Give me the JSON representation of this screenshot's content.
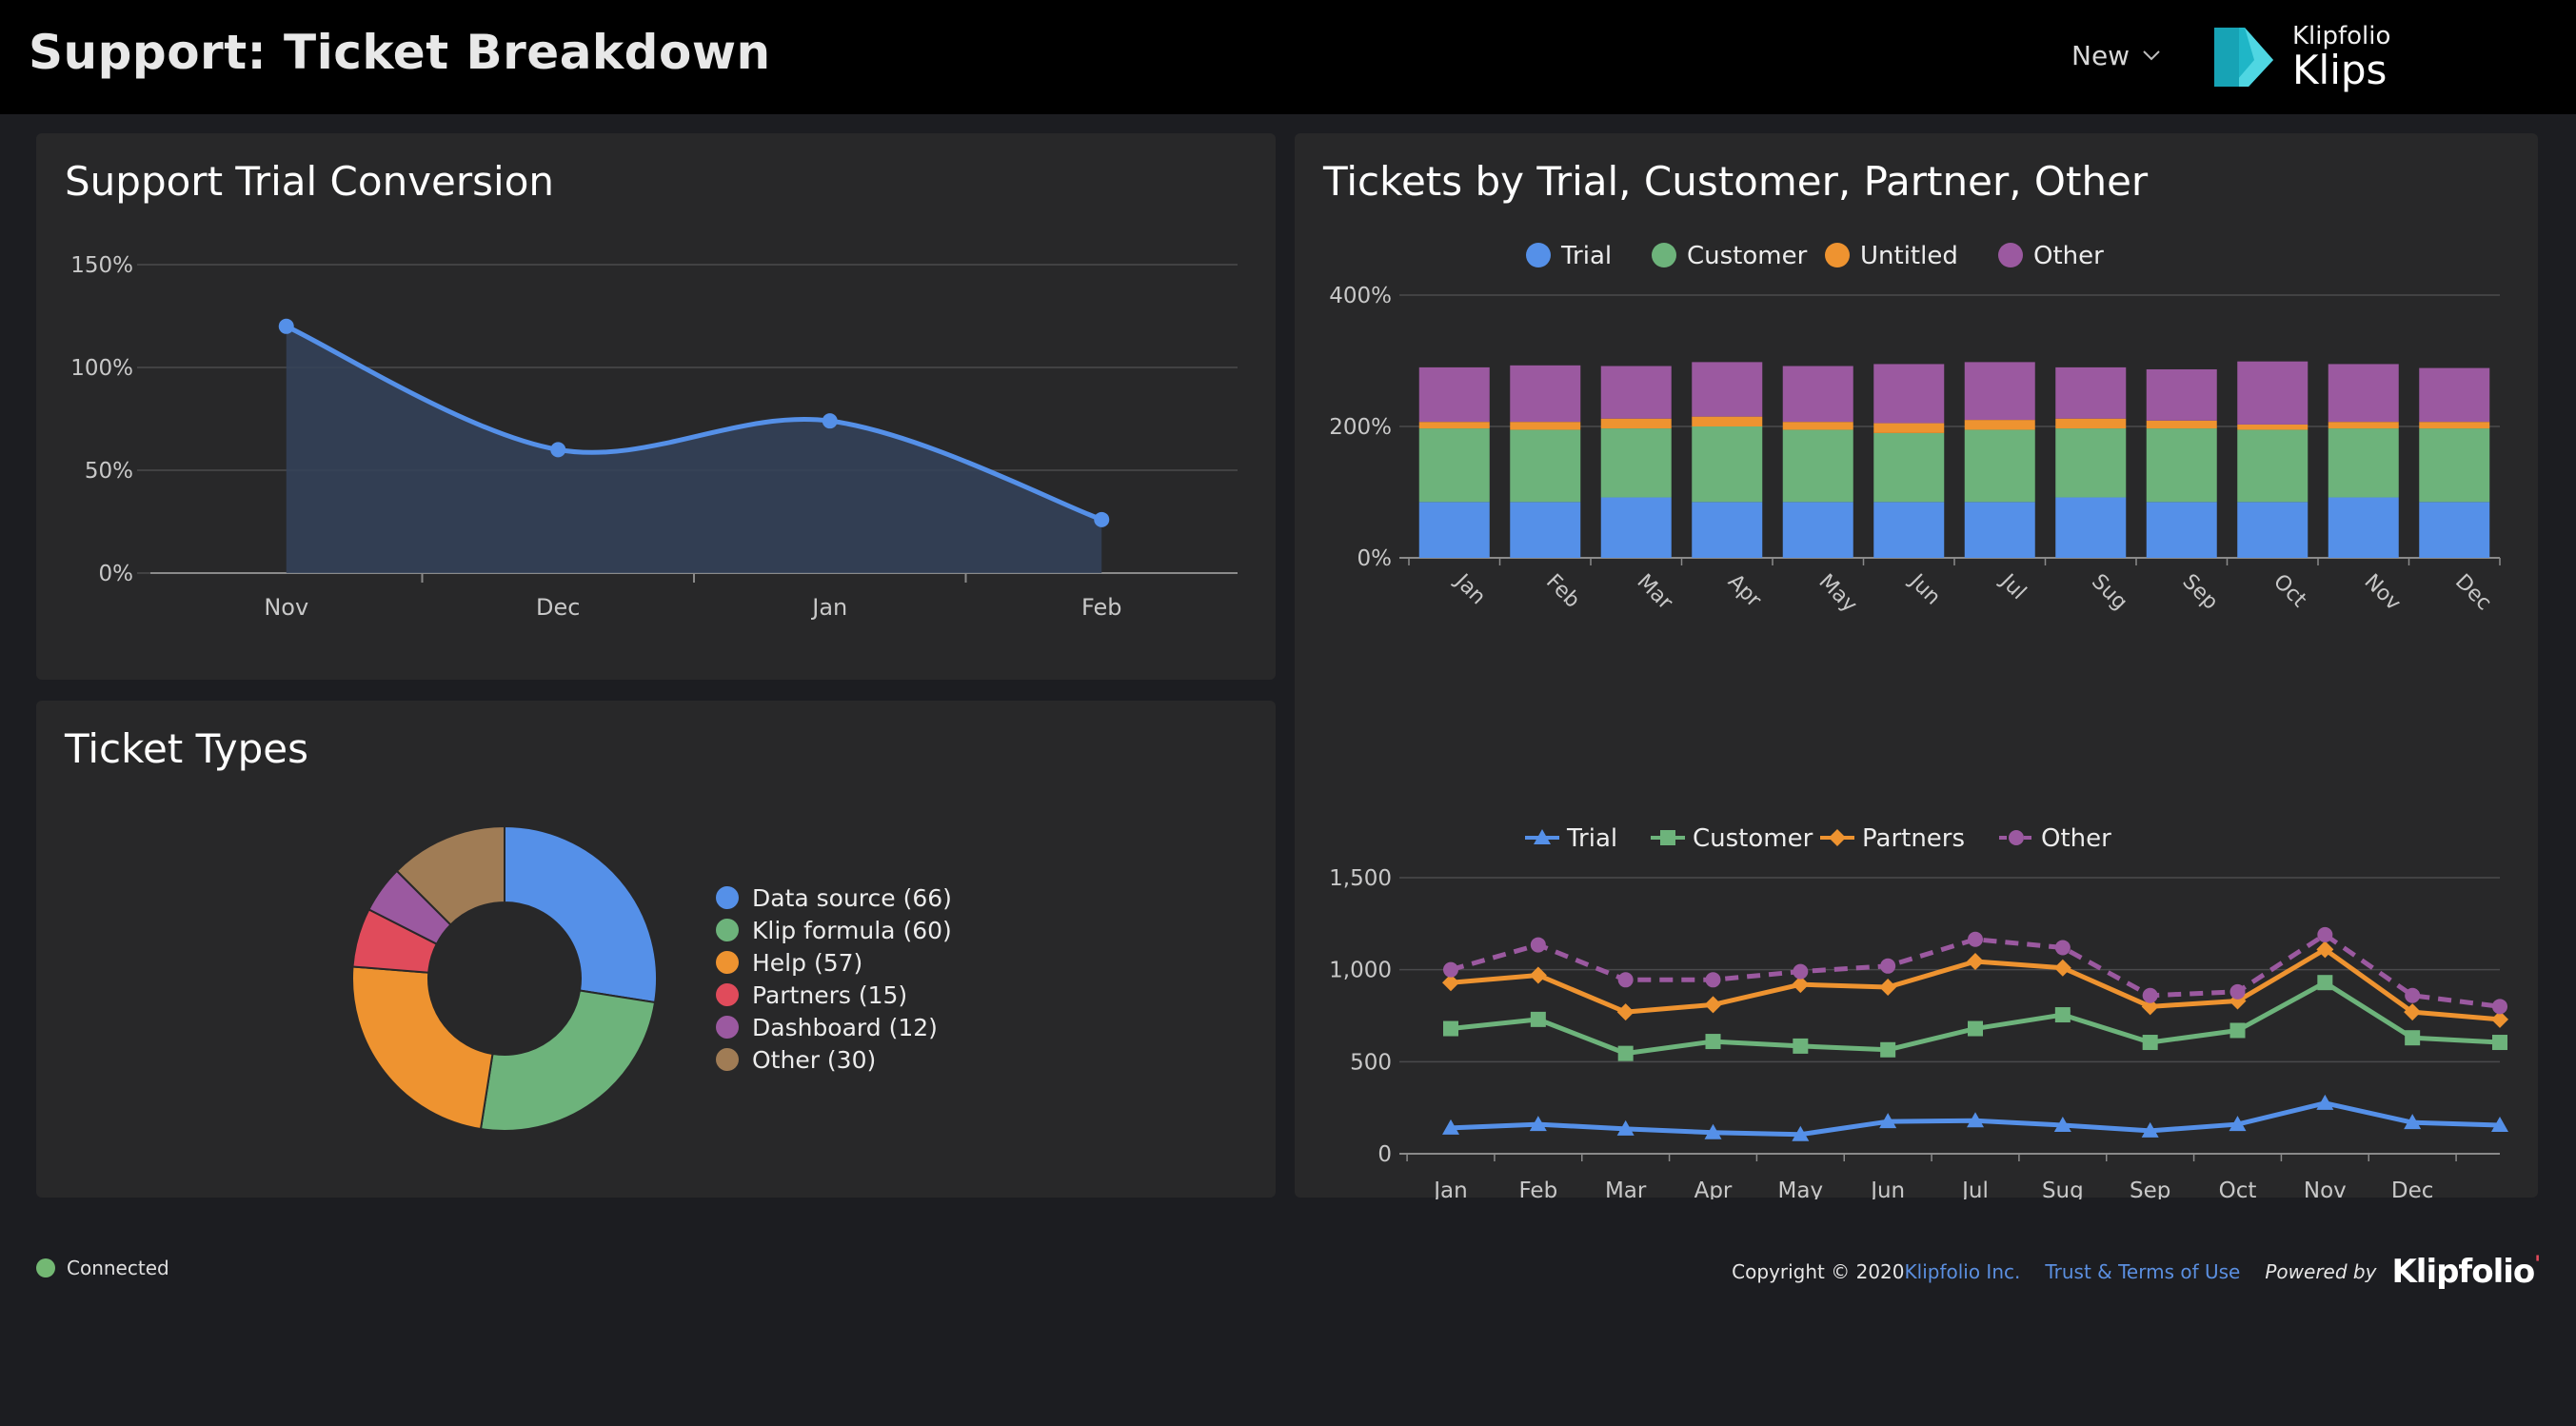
{
  "header": {
    "title": "Support: Ticket Breakdown",
    "new_label": "New",
    "brand_small": "Klipfolio",
    "brand_big": "Klips"
  },
  "panels": {
    "conversion": {
      "title": "Support Trial Conversion"
    },
    "ticket_types": {
      "title": "Ticket Types"
    },
    "tickets_by": {
      "title": "Tickets by Trial, Customer, Partner, Other"
    }
  },
  "chart_data": [
    {
      "id": "conversion",
      "type": "area",
      "categories": [
        "Nov",
        "Dec",
        "Jan",
        "Feb"
      ],
      "values": [
        120,
        60,
        74,
        26
      ],
      "ylim": [
        0,
        150
      ],
      "yticks": [
        "0%",
        "50%",
        "100%",
        "150%"
      ],
      "color": "#5590e8"
    },
    {
      "id": "ticket_types",
      "type": "pie",
      "labels": [
        "Data source (66)",
        "Klip formula (60)",
        "Help (57)",
        "Partners (15)",
        "Dashboard (12)",
        "Other (30)"
      ],
      "values": [
        66,
        60,
        57,
        15,
        12,
        30
      ],
      "colors": [
        "#5590e8",
        "#6db37b",
        "#ee9330",
        "#e04b5b",
        "#9b59a0",
        "#a07c55"
      ]
    },
    {
      "id": "stacked",
      "type": "bar",
      "categories": [
        "Jan",
        "Feb",
        "Mar",
        "Apr",
        "May",
        "Jun",
        "Jul",
        "Sug",
        "Sep",
        "Oct",
        "Nov",
        "Dec"
      ],
      "ylim": [
        0,
        400
      ],
      "yticks": [
        "0%",
        "200%",
        "400%"
      ],
      "series": [
        {
          "name": "Trial",
          "color": "#5590e8",
          "values": [
            85,
            85,
            92,
            85,
            85,
            85,
            85,
            92,
            85,
            85,
            92,
            85
          ]
        },
        {
          "name": "Customer",
          "color": "#6db37b",
          "values": [
            112,
            110,
            105,
            115,
            110,
            105,
            110,
            105,
            112,
            110,
            105,
            112
          ]
        },
        {
          "name": "Untitled",
          "color": "#ee9330",
          "values": [
            10,
            12,
            15,
            15,
            12,
            15,
            15,
            15,
            12,
            8,
            10,
            10
          ]
        },
        {
          "name": "Other",
          "color": "#9b59a0",
          "values": [
            83,
            86,
            80,
            83,
            85,
            90,
            88,
            78,
            78,
            96,
            88,
            82
          ]
        }
      ]
    },
    {
      "id": "lines",
      "type": "line",
      "categories": [
        "Jan",
        "Feb",
        "Mar",
        "Apr",
        "May",
        "Jun",
        "Jul",
        "Sug",
        "Sep",
        "Oct",
        "Nov",
        "Dec"
      ],
      "ylim": [
        0,
        1500
      ],
      "yticks": [
        "0",
        "500",
        "1,000",
        "1,500"
      ],
      "series": [
        {
          "name": "Trial",
          "color": "#5590e8",
          "marker": "triangle",
          "dashed": false,
          "values": [
            140,
            160,
            135,
            115,
            105,
            175,
            180,
            155,
            125,
            160,
            275,
            170,
            155
          ]
        },
        {
          "name": "Customer",
          "color": "#6db37b",
          "marker": "square",
          "dashed": false,
          "values": [
            680,
            730,
            545,
            610,
            585,
            565,
            680,
            755,
            605,
            670,
            930,
            630,
            605
          ]
        },
        {
          "name": "Partners",
          "color": "#ee9330",
          "marker": "diamond",
          "dashed": false,
          "values": [
            930,
            970,
            770,
            810,
            920,
            905,
            1045,
            1010,
            800,
            830,
            1110,
            770,
            730
          ]
        },
        {
          "name": "Other",
          "color": "#9b59a0",
          "marker": "circle",
          "dashed": true,
          "values": [
            1000,
            1135,
            945,
            945,
            990,
            1020,
            1165,
            1120,
            860,
            880,
            1190,
            860,
            800
          ]
        }
      ]
    }
  ],
  "footer": {
    "status": "Connected",
    "copyright": "Copyright © 2020 ",
    "company_link": "Klipfolio Inc.",
    "terms_link": "Trust & Terms of Use",
    "powered_by": "Powered by",
    "logo": "Klipfolio"
  }
}
